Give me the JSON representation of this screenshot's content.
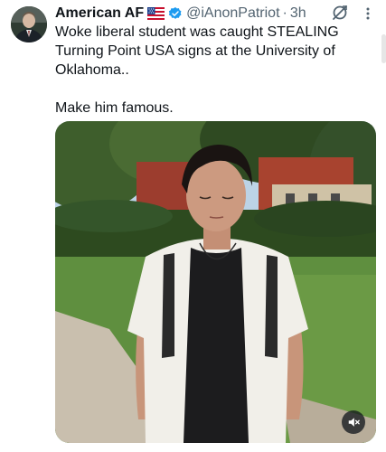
{
  "tweet": {
    "author_name": "American AF",
    "flag_icon": "us-flag-icon",
    "verified_icon": "verified-badge-icon",
    "verified_color": "#1d9bf0",
    "handle": "@iAnonPatriot",
    "separator": "·",
    "time": "3h",
    "text_line1": "Woke liberal student was caught STEALING Turning Point USA signs at the University of Oklahoma..",
    "text_line2": "Make him famous."
  },
  "actions": {
    "grok_icon": "grok-icon",
    "more_icon": "more-options-icon"
  },
  "media": {
    "type": "video",
    "mute_icon": "volume-muted-icon"
  }
}
